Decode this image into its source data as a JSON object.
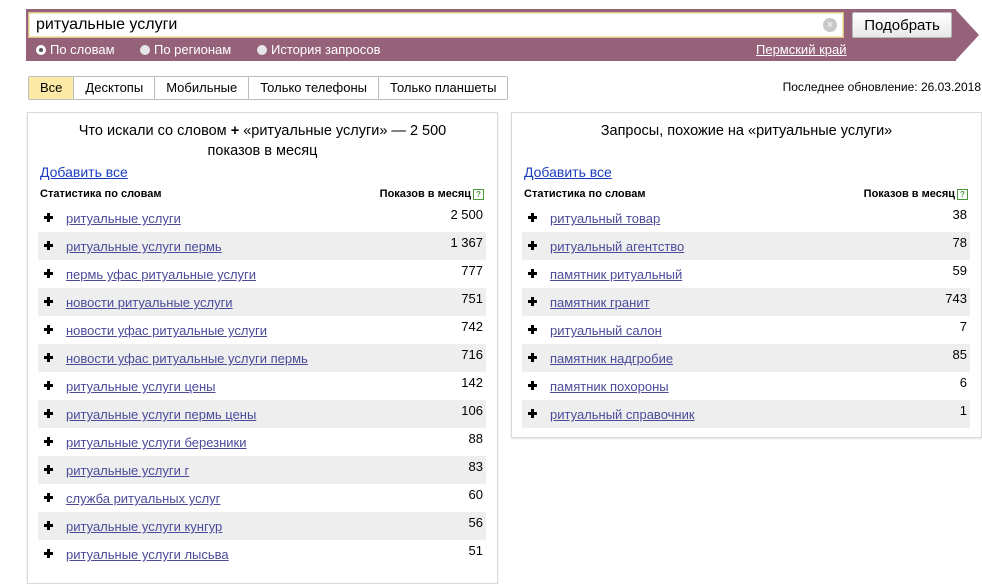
{
  "search": {
    "value": "ритуальные услуги",
    "submit_label": "Подобрать",
    "clear_glyph": "×",
    "modes": [
      {
        "label": "По словам",
        "checked": true
      },
      {
        "label": "По регионам",
        "checked": false
      },
      {
        "label": "История запросов",
        "checked": false
      }
    ],
    "region": "Пермский край"
  },
  "tabs": [
    {
      "label": "Все",
      "active": true
    },
    {
      "label": "Десктопы",
      "active": false
    },
    {
      "label": "Мобильные",
      "active": false
    },
    {
      "label": "Только телефоны",
      "active": false
    },
    {
      "label": "Только планшеты",
      "active": false
    }
  ],
  "last_update": "Последнее обновление: 26.03.2018",
  "left_panel": {
    "title_prefix": "Что искали со словом",
    "title_plus": "+",
    "title_suffix": "«ритуальные услуги» — 2 500",
    "title_line2": "показов в месяц",
    "add_all": "Добавить все",
    "col_words": "Статистика по словам",
    "col_count": "Показов в месяц",
    "help": "?",
    "rows": [
      {
        "keyword": "ритуальные услуги",
        "count": "2 500"
      },
      {
        "keyword": "ритуальные услуги пермь",
        "count": "1 367"
      },
      {
        "keyword": "пермь уфас ритуальные услуги",
        "count": "777"
      },
      {
        "keyword": "новости ритуальные услуги",
        "count": "751"
      },
      {
        "keyword": "новости уфас ритуальные услуги",
        "count": "742"
      },
      {
        "keyword": "новости уфас ритуальные услуги пермь",
        "count": "716"
      },
      {
        "keyword": "ритуальные услуги цены",
        "count": "142"
      },
      {
        "keyword": "ритуальные услуги пермь цены",
        "count": "106"
      },
      {
        "keyword": "ритуальные услуги березники",
        "count": "88"
      },
      {
        "keyword": "ритуальные услуги г",
        "count": "83"
      },
      {
        "keyword": "служба ритуальных услуг",
        "count": "60"
      },
      {
        "keyword": "ритуальные услуги кунгур",
        "count": "56"
      },
      {
        "keyword": "ритуальные услуги лысьва",
        "count": "51"
      }
    ]
  },
  "right_panel": {
    "title": "Запросы, похожие на «ритуальные услуги»",
    "add_all": "Добавить все",
    "col_words": "Статистика по словам",
    "col_count": "Показов в месяц",
    "help": "?",
    "rows": [
      {
        "keyword": "ритуальный товар",
        "count": "38"
      },
      {
        "keyword": "ритуальный агентство",
        "count": "78"
      },
      {
        "keyword": "памятник ритуальный",
        "count": "59"
      },
      {
        "keyword": "памятник гранит",
        "count": "743"
      },
      {
        "keyword": "ритуальный салон",
        "count": "7"
      },
      {
        "keyword": "памятник надгробие",
        "count": "85"
      },
      {
        "keyword": "памятник похороны",
        "count": "6"
      },
      {
        "keyword": "ритуальный справочник",
        "count": "1"
      }
    ]
  },
  "colors": {
    "header": "#966279",
    "active_tab": "#fde9a6",
    "link": "#4b4b9a",
    "add_all_link": "#1a3dc1",
    "row_alt": "#eeeeee"
  }
}
